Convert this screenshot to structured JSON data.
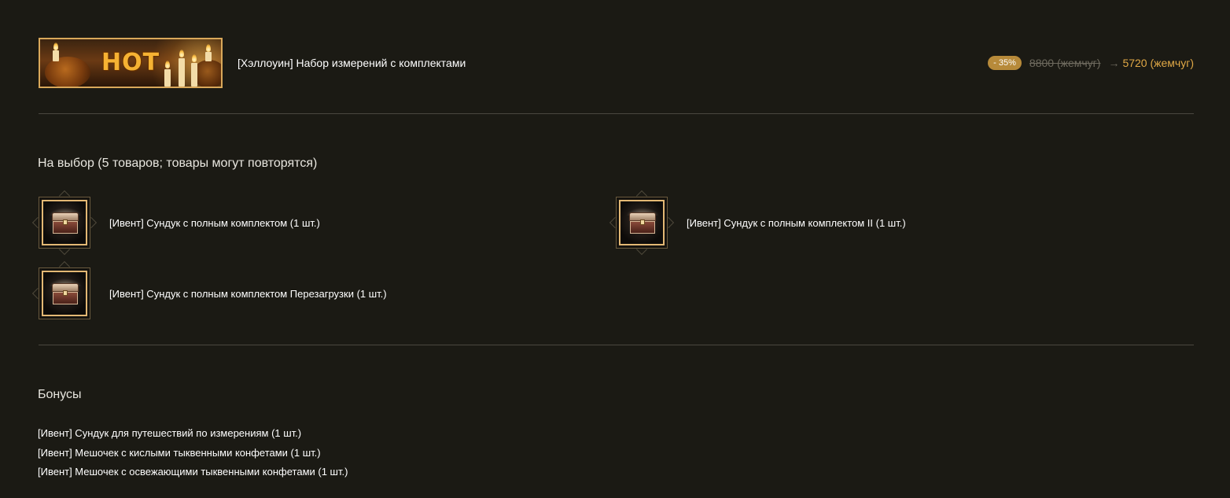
{
  "header": {
    "banner_text": "HOT",
    "product_title": "[Хэллоуин] Набор измерений с комплектами",
    "discount": "- 35%",
    "old_price": "8800 (жемчуг)",
    "arrow": "→",
    "new_price": "5720 (жемчуг)"
  },
  "choice_section": {
    "title": "На выбор (5 товаров; товары могут повторятся)",
    "items": [
      {
        "label": "[Ивент] Сундук с полным комплектом (1 шт.)",
        "icon": "chest-icon"
      },
      {
        "label": "[Ивент] Сундук с полным комплектом II (1 шт.)",
        "icon": "chest-icon"
      },
      {
        "label": "[Ивент] Сундук с полным комплектом Перезагрузки (1 шт.)",
        "icon": "chest-icon"
      }
    ]
  },
  "bonus_section": {
    "title": "Бонусы",
    "items": [
      "[Ивент] Сундук для путешествий по измерениям (1 шт.)",
      "[Ивент] Мешочек с кислыми тыквенными конфетами (1 шт.)",
      "[Ивент] Мешочек с освежающими тыквенными конфетами (1 шт.)"
    ]
  },
  "colors": {
    "background": "#1b1a14",
    "accent_gold": "#e0a846",
    "badge": "#b78a3a",
    "divider": "#4a4740"
  }
}
